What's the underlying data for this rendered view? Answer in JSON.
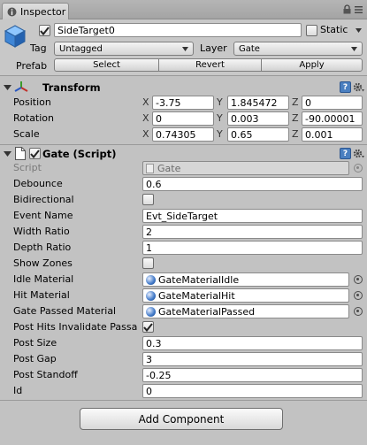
{
  "tab": {
    "label": "Inspector"
  },
  "object": {
    "name": "SideTarget0",
    "active": true,
    "static_label": "Static",
    "static": false,
    "tag_label": "Tag",
    "tag_value": "Untagged",
    "layer_label": "Layer",
    "layer_value": "Gate",
    "prefab_label": "Prefab",
    "prefab_buttons": {
      "select": "Select",
      "revert": "Revert",
      "apply": "Apply"
    }
  },
  "transform": {
    "title": "Transform",
    "rows": [
      {
        "label": "Position",
        "x": "-3.75",
        "y": "1.845472",
        "z": "0"
      },
      {
        "label": "Rotation",
        "x": "0",
        "y": "0.003",
        "z": "-90.00001"
      },
      {
        "label": "Scale",
        "x": "0.74305",
        "y": "0.65",
        "z": "0.001"
      }
    ],
    "axes": {
      "x": "X",
      "y": "Y",
      "z": "Z"
    }
  },
  "gate": {
    "title": "Gate (Script)",
    "enabled": true,
    "script_label": "Script",
    "script_value": "Gate",
    "fields": {
      "debounce": {
        "label": "Debounce",
        "value": "0.6"
      },
      "bidirectional": {
        "label": "Bidirectional",
        "checked": false
      },
      "event_name": {
        "label": "Event Name",
        "value": "Evt_SideTarget"
      },
      "width_ratio": {
        "label": "Width Ratio",
        "value": "2"
      },
      "depth_ratio": {
        "label": "Depth Ratio",
        "value": "1"
      },
      "show_zones": {
        "label": "Show Zones",
        "checked": false
      },
      "idle_material": {
        "label": "Idle Material",
        "value": "GateMaterialIdle"
      },
      "hit_material": {
        "label": "Hit Material",
        "value": "GateMaterialHit"
      },
      "passed_material": {
        "label": "Gate Passed Material",
        "value": "GateMaterialPassed"
      },
      "post_hits": {
        "label": "Post Hits Invalidate Passa",
        "checked": true
      },
      "post_size": {
        "label": "Post Size",
        "value": "0.3"
      },
      "post_gap": {
        "label": "Post Gap",
        "value": "3"
      },
      "post_standoff": {
        "label": "Post Standoff",
        "value": "-0.25"
      },
      "id": {
        "label": "Id",
        "value": "0"
      }
    }
  },
  "add_component": "Add Component",
  "colors": {
    "panel": "#c2c2c2",
    "help_blue": "#4a7fc0",
    "field_bg": "#ffffff"
  }
}
